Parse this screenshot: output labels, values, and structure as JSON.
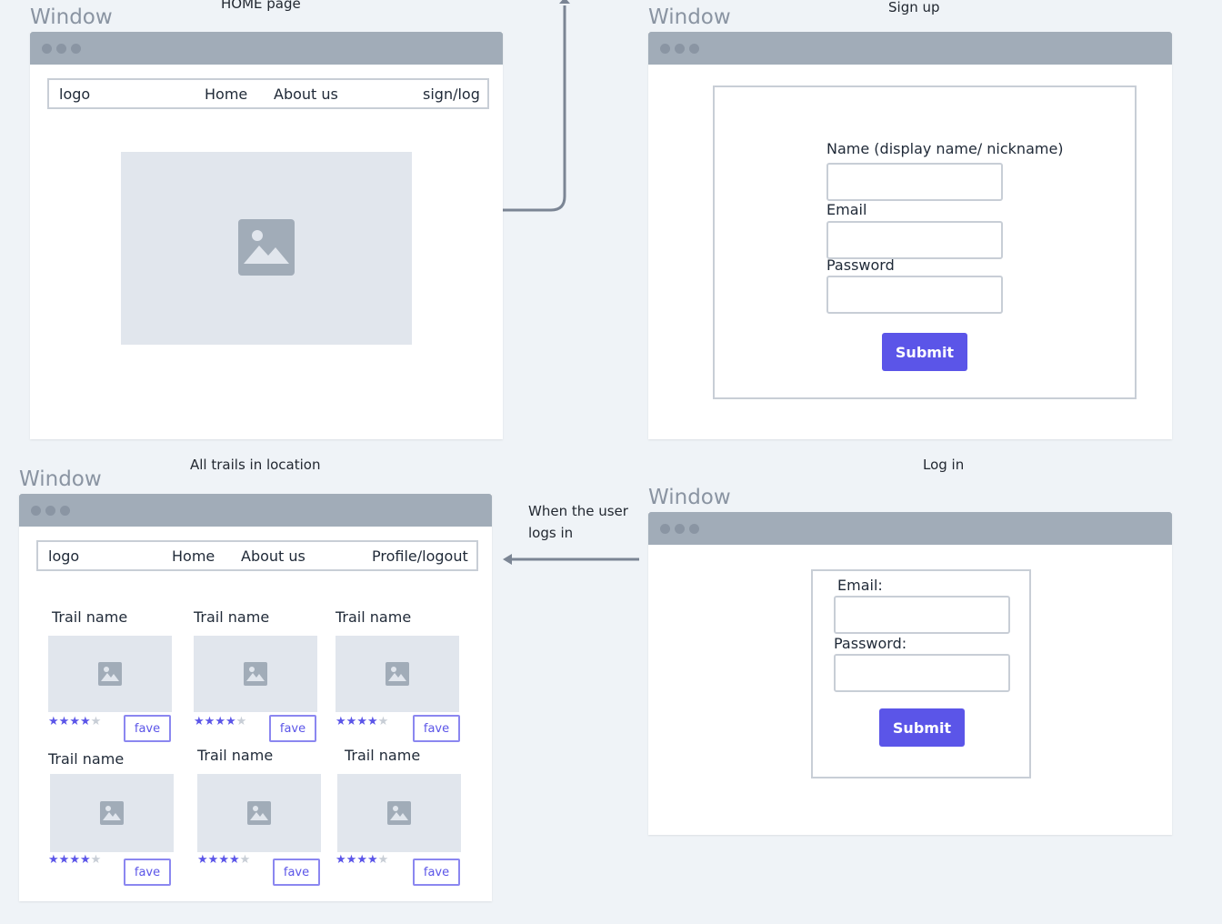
{
  "captions": {
    "home": "HOME page",
    "signup": "Sign up",
    "trails": "All trails in location",
    "login": "Log in",
    "transition_line1": "When the user",
    "transition_line2": "logs in"
  },
  "window_label": "Window",
  "home": {
    "nav": {
      "logo": "logo",
      "home": "Home",
      "about": "About us",
      "auth": "sign/log"
    }
  },
  "signup": {
    "name_label": "Name   (display name/ nickname)",
    "email_label": "Email",
    "password_label": "Password",
    "submit_label": "Submit"
  },
  "login": {
    "email_label": "Email:",
    "password_label": "Password:",
    "submit_label": "Submit"
  },
  "trails": {
    "nav": {
      "logo": "logo",
      "home": "Home",
      "about": "About us",
      "auth": "Profile/logout"
    },
    "cards": [
      {
        "name": "Trail name",
        "rating": 4,
        "max_rating": 5,
        "fave_label": "fave"
      },
      {
        "name": "Trail name",
        "rating": 4,
        "max_rating": 5,
        "fave_label": "fave"
      },
      {
        "name": "Trail name",
        "rating": 4,
        "max_rating": 5,
        "fave_label": "fave"
      },
      {
        "name": "Trail name",
        "rating": 4,
        "max_rating": 5,
        "fave_label": "fave"
      },
      {
        "name": "Trail name",
        "rating": 4,
        "max_rating": 5,
        "fave_label": "fave"
      },
      {
        "name": "Trail name",
        "rating": 4,
        "max_rating": 5,
        "fave_label": "fave"
      }
    ]
  },
  "colors": {
    "background": "#eff3f7",
    "titlebar": "#a1acb8",
    "accent": "#5b55e8",
    "placeholder": "#e1e6ed",
    "connector": "#7b8594"
  }
}
